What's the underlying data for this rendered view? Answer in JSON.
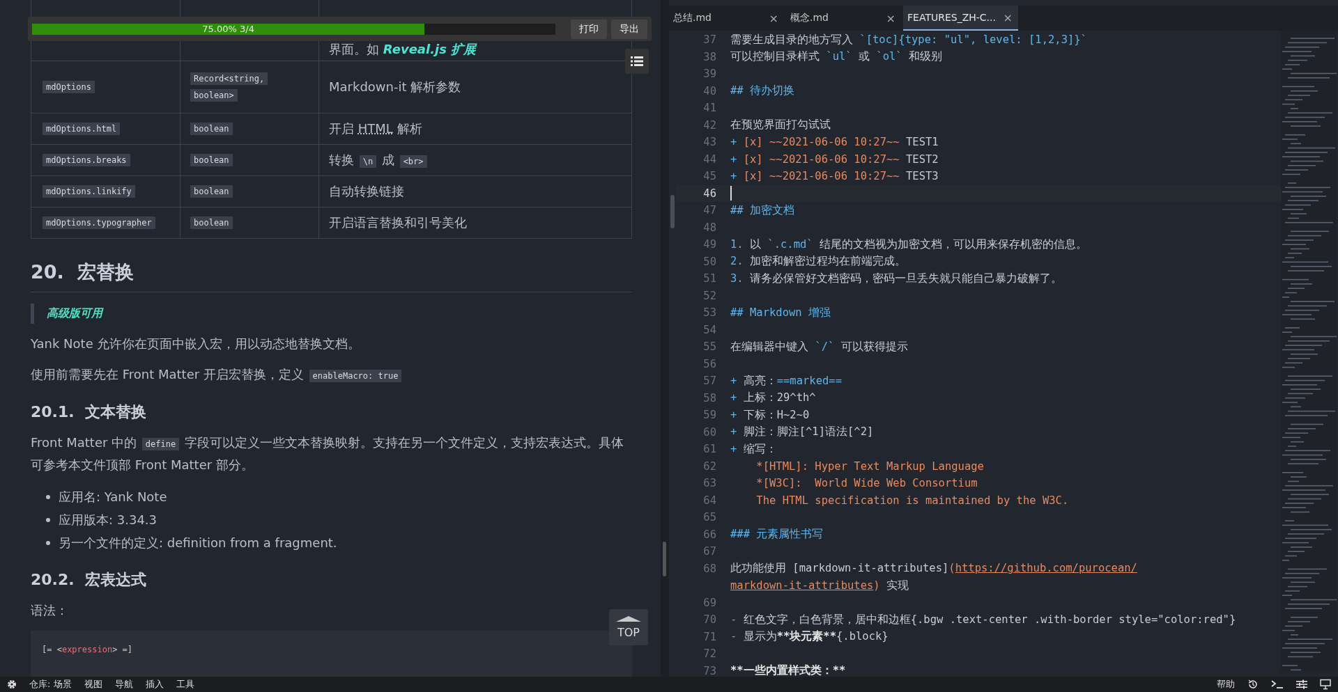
{
  "progress": {
    "level": 0.75,
    "label": "75.00% 3/4",
    "buttons": [
      "打印",
      "导出"
    ]
  },
  "preview": {
    "table_rows": [
      {
        "desc": [
          {
            "kind": "text",
            "text": "界面。如 "
          },
          {
            "kind": "link",
            "text": "Reveal.js 扩展"
          }
        ]
      },
      {
        "name": "mdOptions",
        "type": [
          "Record<string,",
          "boolean>"
        ],
        "desc": [
          {
            "kind": "text",
            "text": "Markdown-it 解析参数"
          }
        ]
      },
      {
        "name": "mdOptions.html",
        "type": [
          "boolean"
        ],
        "desc": [
          {
            "kind": "text",
            "text": "开启 "
          },
          {
            "kind": "abbr",
            "text": "HTML"
          },
          {
            "kind": "text",
            "text": " 解析"
          }
        ]
      },
      {
        "name": "mdOptions.breaks",
        "type": [
          "boolean"
        ],
        "desc": [
          {
            "kind": "text",
            "text": "转换 "
          },
          {
            "kind": "code",
            "text": "\\n"
          },
          {
            "kind": "text",
            "text": " 成 "
          },
          {
            "kind": "code",
            "text": "<br>"
          }
        ]
      },
      {
        "name": "mdOptions.linkify",
        "type": [
          "boolean"
        ],
        "desc": [
          {
            "kind": "text",
            "text": "自动转换链接"
          }
        ]
      },
      {
        "name": "mdOptions.typographer",
        "type": [
          "boolean"
        ],
        "desc": [
          {
            "kind": "text",
            "text": "开启语言替换和引号美化"
          }
        ]
      }
    ],
    "blocks": [
      {
        "kind": "h2",
        "number": "20.",
        "text": "宏替换"
      },
      {
        "kind": "quote",
        "text": "高级版可用"
      },
      {
        "kind": "p",
        "segments": [
          {
            "kind": "text",
            "text": "Yank Note 允许你在页面中嵌入宏，用以动态地替换文档。"
          }
        ]
      },
      {
        "kind": "p",
        "segments": [
          {
            "kind": "text",
            "text": "使用前需要先在 Front Matter 开启宏替换，定义 "
          },
          {
            "kind": "code",
            "text": "enableMacro: true"
          }
        ]
      },
      {
        "kind": "h3",
        "number": "20.1.",
        "text": "文本替换"
      },
      {
        "kind": "p",
        "segments": [
          {
            "kind": "text",
            "text": "Front Matter 中的 "
          },
          {
            "kind": "code",
            "text": "define"
          },
          {
            "kind": "text",
            "text": " 字段可以定义一些文本替换映射。支持在另一个文件定义，支持宏表达式。具体可参考本文件顶部 Front Matter 部分。"
          }
        ]
      },
      {
        "kind": "list",
        "items": [
          "应用名: Yank Note",
          "应用版本: 3.34.3",
          "另一个文件的定义: definition from a fragment."
        ]
      },
      {
        "kind": "h3",
        "number": "20.2.",
        "text": "宏表达式"
      },
      {
        "kind": "p",
        "segments": [
          {
            "kind": "text",
            "text": "语法："
          }
        ]
      },
      {
        "kind": "code",
        "segments": [
          {
            "kind": "punct",
            "text": "[= <"
          },
          {
            "kind": "tag",
            "text": "expression"
          },
          {
            "kind": "punct",
            "text": "> =]"
          }
        ]
      }
    ],
    "top_button": "TOP"
  },
  "editor": {
    "tabs": [
      {
        "label": "总结.md",
        "close": "×",
        "selected": false
      },
      {
        "label": "概念.md",
        "close": "×",
        "selected": false
      },
      {
        "label": "FEATURES_ZH-C...",
        "close": "×",
        "selected": true
      }
    ],
    "lines": [
      {
        "number": "37",
        "cursor": false,
        "segments": [
          {
            "kind": "plain",
            "text": "需要生成目录的地方写入 "
          },
          {
            "kind": "accent",
            "text": "`[toc]{type: \"ul\", level: [1,2,3]}`"
          }
        ]
      },
      {
        "number": "38",
        "cursor": false,
        "segments": [
          {
            "kind": "plain",
            "text": "可以控制目录样式 "
          },
          {
            "kind": "accent",
            "text": "`ul`"
          },
          {
            "kind": "plain",
            "text": " 或 "
          },
          {
            "kind": "accent",
            "text": "`ol`"
          },
          {
            "kind": "plain",
            "text": " 和级别"
          }
        ]
      },
      {
        "number": "39",
        "cursor": false
      },
      {
        "number": "40",
        "cursor": false,
        "segments": [
          {
            "kind": "accent",
            "text": "## 待办切换"
          }
        ]
      },
      {
        "number": "41",
        "cursor": false
      },
      {
        "number": "42",
        "cursor": false,
        "segments": [
          {
            "kind": "plain",
            "text": "在预览界面打勾试试"
          }
        ]
      },
      {
        "number": "43",
        "cursor": false,
        "segments": [
          {
            "kind": "accent",
            "text": "+ "
          },
          {
            "kind": "orange",
            "text": "[x] ~~2021-06-06 10:27~~"
          },
          {
            "kind": "plain",
            "text": " TEST1"
          }
        ]
      },
      {
        "number": "44",
        "cursor": false,
        "segments": [
          {
            "kind": "accent",
            "text": "+ "
          },
          {
            "kind": "orange",
            "text": "[x] ~~2021-06-06 10:27~~"
          },
          {
            "kind": "plain",
            "text": " TEST2"
          }
        ]
      },
      {
        "number": "45",
        "cursor": false,
        "segments": [
          {
            "kind": "accent",
            "text": "+ "
          },
          {
            "kind": "orange",
            "text": "[x] ~~2021-06-06 10:27~~"
          },
          {
            "kind": "plain",
            "text": " TEST3"
          }
        ]
      },
      {
        "number": "46",
        "cursor": true
      },
      {
        "number": "47",
        "cursor": false,
        "segments": [
          {
            "kind": "accent",
            "text": "## 加密文档"
          }
        ]
      },
      {
        "number": "48",
        "cursor": false
      },
      {
        "number": "49",
        "cursor": false,
        "segments": [
          {
            "kind": "accent",
            "text": "1. "
          },
          {
            "kind": "plain",
            "text": "以 "
          },
          {
            "kind": "accent",
            "text": "`.c.md`"
          },
          {
            "kind": "plain",
            "text": " 结尾的文档视为加密文档，可以用来保存机密的信息。"
          }
        ]
      },
      {
        "number": "50",
        "cursor": false,
        "segments": [
          {
            "kind": "accent",
            "text": "2. "
          },
          {
            "kind": "plain",
            "text": "加密和解密过程均在前端完成。"
          }
        ]
      },
      {
        "number": "51",
        "cursor": false,
        "segments": [
          {
            "kind": "accent",
            "text": "3. "
          },
          {
            "kind": "plain",
            "text": "请务必保管好文档密码，密码一旦丢失就只能自己暴力破解了。"
          }
        ]
      },
      {
        "number": "52",
        "cursor": false
      },
      {
        "number": "53",
        "cursor": false,
        "segments": [
          {
            "kind": "accent",
            "text": "## Markdown 增强"
          }
        ]
      },
      {
        "number": "54",
        "cursor": false
      },
      {
        "number": "55",
        "cursor": false,
        "segments": [
          {
            "kind": "plain",
            "text": "在编辑器中键入 "
          },
          {
            "kind": "accent",
            "text": "`/`"
          },
          {
            "kind": "plain",
            "text": " 可以获得提示"
          }
        ]
      },
      {
        "number": "56",
        "cursor": false
      },
      {
        "number": "57",
        "cursor": false,
        "segments": [
          {
            "kind": "accent",
            "text": "+ "
          },
          {
            "kind": "plain",
            "text": "高亮："
          },
          {
            "kind": "accent",
            "text": "==marked=="
          }
        ]
      },
      {
        "number": "58",
        "cursor": false,
        "segments": [
          {
            "kind": "accent",
            "text": "+ "
          },
          {
            "kind": "plain",
            "text": "上标：29^th^"
          }
        ]
      },
      {
        "number": "59",
        "cursor": false,
        "segments": [
          {
            "kind": "accent",
            "text": "+ "
          },
          {
            "kind": "plain",
            "text": "下标：H~2~0"
          }
        ]
      },
      {
        "number": "60",
        "cursor": false,
        "segments": [
          {
            "kind": "accent",
            "text": "+ "
          },
          {
            "kind": "plain",
            "text": "脚注：脚注[^1]语法[^2]"
          }
        ]
      },
      {
        "number": "61",
        "cursor": false,
        "segments": [
          {
            "kind": "accent",
            "text": "+ "
          },
          {
            "kind": "plain",
            "text": "缩写："
          }
        ]
      },
      {
        "number": "62",
        "cursor": false,
        "segments": [
          {
            "kind": "orange",
            "text": "    *[HTML]: Hyper Text Markup Language"
          }
        ]
      },
      {
        "number": "63",
        "cursor": false,
        "segments": [
          {
            "kind": "orange",
            "text": "    *[W3C]:  World Wide Web Consortium"
          }
        ]
      },
      {
        "number": "64",
        "cursor": false,
        "segments": [
          {
            "kind": "orange",
            "text": "    The HTML specification is maintained by the W3C."
          }
        ]
      },
      {
        "number": "65",
        "cursor": false
      },
      {
        "number": "66",
        "cursor": false,
        "segments": [
          {
            "kind": "accent",
            "text": "### 元素属性书写"
          }
        ]
      },
      {
        "number": "67",
        "cursor": false
      },
      {
        "number": "68",
        "cursor": false,
        "segments": [
          {
            "kind": "plain",
            "text": "此功能使用 [markdown-it-attributes]"
          },
          {
            "kind": "orange",
            "text": "("
          },
          {
            "kind": "link",
            "text": "https://github.com/purocean/"
          }
        ]
      },
      {
        "cursor": false,
        "segments": [
          {
            "kind": "link",
            "text": "markdown-it-attributes"
          },
          {
            "kind": "orange",
            "text": ")"
          },
          {
            "kind": "plain",
            "text": " 实现"
          }
        ]
      },
      {
        "number": "69",
        "cursor": false
      },
      {
        "number": "70",
        "cursor": false,
        "segments": [
          {
            "kind": "dim",
            "text": "- "
          },
          {
            "kind": "plain",
            "text": "红色文字，白色背景，居中和边框{.bgw .text-center .with-border style=\"color:red\"}"
          }
        ]
      },
      {
        "number": "71",
        "cursor": false,
        "segments": [
          {
            "kind": "dim",
            "text": "- "
          },
          {
            "kind": "plain",
            "text": "显示为"
          },
          {
            "kind": "bold",
            "text": "**块元素**"
          },
          {
            "kind": "plain",
            "text": "{.block}"
          }
        ]
      },
      {
        "number": "72",
        "cursor": false
      },
      {
        "number": "73",
        "cursor": false,
        "segments": [
          {
            "kind": "bold",
            "text": "**一些内置样式类：**"
          }
        ]
      }
    ]
  },
  "status_bar": {
    "left": [
      "仓库: 场景",
      "视图",
      "导航",
      "插入",
      "工具"
    ],
    "right": [
      "帮助"
    ]
  }
}
